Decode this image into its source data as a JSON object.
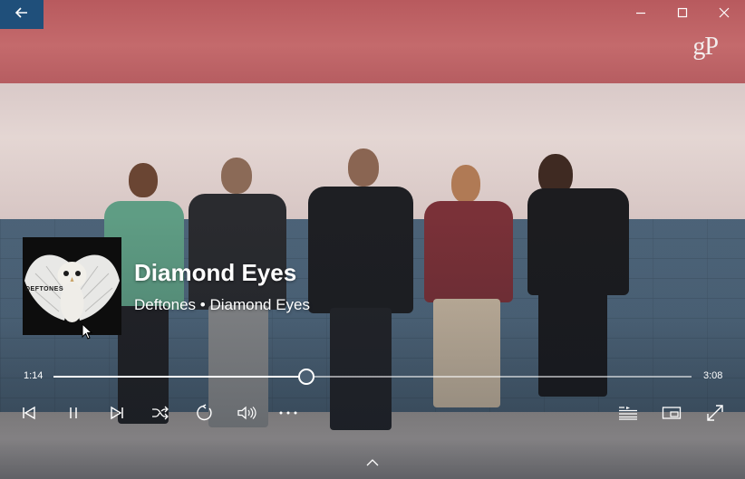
{
  "window": {
    "back_icon": "arrow-left-icon",
    "controls": [
      "minimize-icon",
      "maximize-icon",
      "close-icon"
    ]
  },
  "watermark": "gP",
  "now_playing": {
    "title": "Diamond Eyes",
    "subtitle": "Deftones • Diamond Eyes",
    "album_art_text": "DEFTONES",
    "elapsed": "1:14",
    "total": "3:08",
    "progress": 0.397
  },
  "controls": {
    "left": [
      "previous-icon",
      "pause-icon",
      "next-icon",
      "shuffle-icon",
      "repeat-icon",
      "volume-icon",
      "more-icon"
    ],
    "right": [
      "now-playing-list-icon",
      "mini-view-icon",
      "full-screen-icon"
    ]
  },
  "colors": {
    "accent": "#1f4f7a",
    "text": "#ffffff"
  }
}
